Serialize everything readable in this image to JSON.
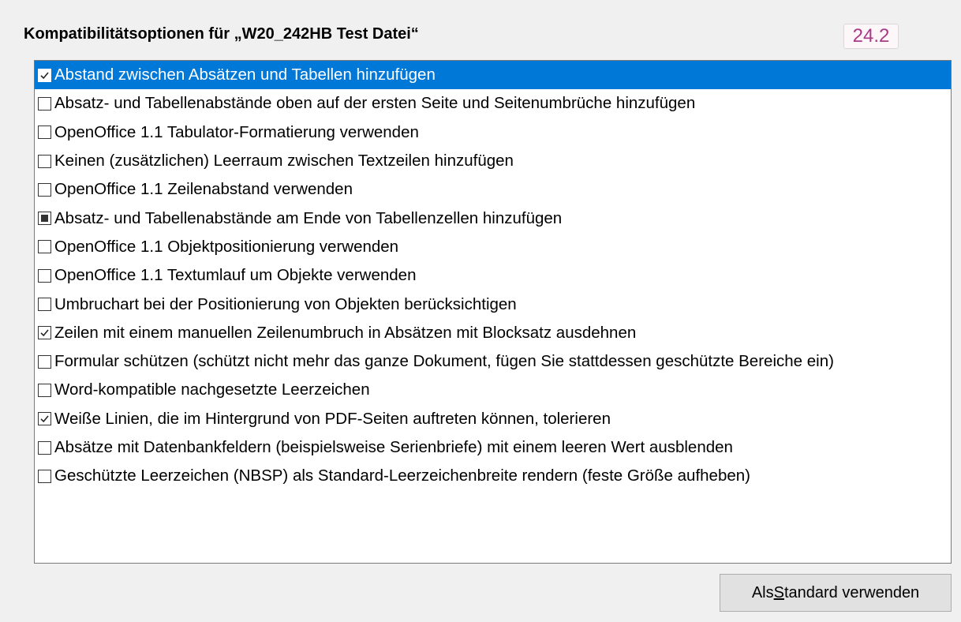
{
  "dialog": {
    "title": "Kompatibilitätsoptionen für „W20_242HB Test Datei“",
    "version": "24.2"
  },
  "options": [
    {
      "label": "Abstand zwischen Absätzen und Tabellen hinzufügen",
      "state": "checked",
      "selected": true
    },
    {
      "label": "Absatz- und Tabellenabstände oben auf der ersten Seite und Seitenumbrüche hinzufügen",
      "state": "unchecked",
      "selected": false
    },
    {
      "label": "OpenOffice 1.1 Tabulator-Formatierung verwenden",
      "state": "unchecked",
      "selected": false
    },
    {
      "label": "Keinen (zusätzlichen) Leerraum zwischen Textzeilen hinzufügen",
      "state": "unchecked",
      "selected": false
    },
    {
      "label": "OpenOffice 1.1 Zeilenabstand verwenden",
      "state": "unchecked",
      "selected": false
    },
    {
      "label": "Absatz- und Tabellenabstände am Ende von Tabellenzellen hinzufügen",
      "state": "indeterminate",
      "selected": false
    },
    {
      "label": "OpenOffice 1.1 Objektpositionierung verwenden",
      "state": "unchecked",
      "selected": false
    },
    {
      "label": "OpenOffice 1.1 Textumlauf um Objekte verwenden",
      "state": "unchecked",
      "selected": false
    },
    {
      "label": "Umbruchart bei der Positionierung von Objekten berücksichtigen",
      "state": "unchecked",
      "selected": false
    },
    {
      "label": "Zeilen mit einem manuellen Zeilenumbruch in Absätzen mit Blocksatz ausdehnen",
      "state": "checked",
      "selected": false
    },
    {
      "label": "Formular schützen (schützt nicht mehr das ganze Dokument, fügen Sie stattdessen geschützte Bereiche ein)",
      "state": "unchecked",
      "selected": false
    },
    {
      "label": "Word-kompatible nachgesetzte Leerzeichen",
      "state": "unchecked",
      "selected": false
    },
    {
      "label": "Weiße Linien, die im Hintergrund von PDF-Seiten auftreten können, tolerieren",
      "state": "checked",
      "selected": false
    },
    {
      "label": "Absätze mit Datenbankfeldern (beispielsweise Serienbriefe) mit einem leeren Wert ausblenden",
      "state": "unchecked",
      "selected": false
    },
    {
      "label": "Geschützte Leerzeichen (NBSP) als Standard-Leerzeichenbreite rendern (feste Größe aufheben)",
      "state": "unchecked",
      "selected": false
    }
  ],
  "buttons": {
    "default_prefix": "Als ",
    "default_mnemonic": "S",
    "default_suffix": "tandard verwenden"
  },
  "colors": {
    "selection": "#0078d7",
    "version_text": "#a83a86"
  }
}
